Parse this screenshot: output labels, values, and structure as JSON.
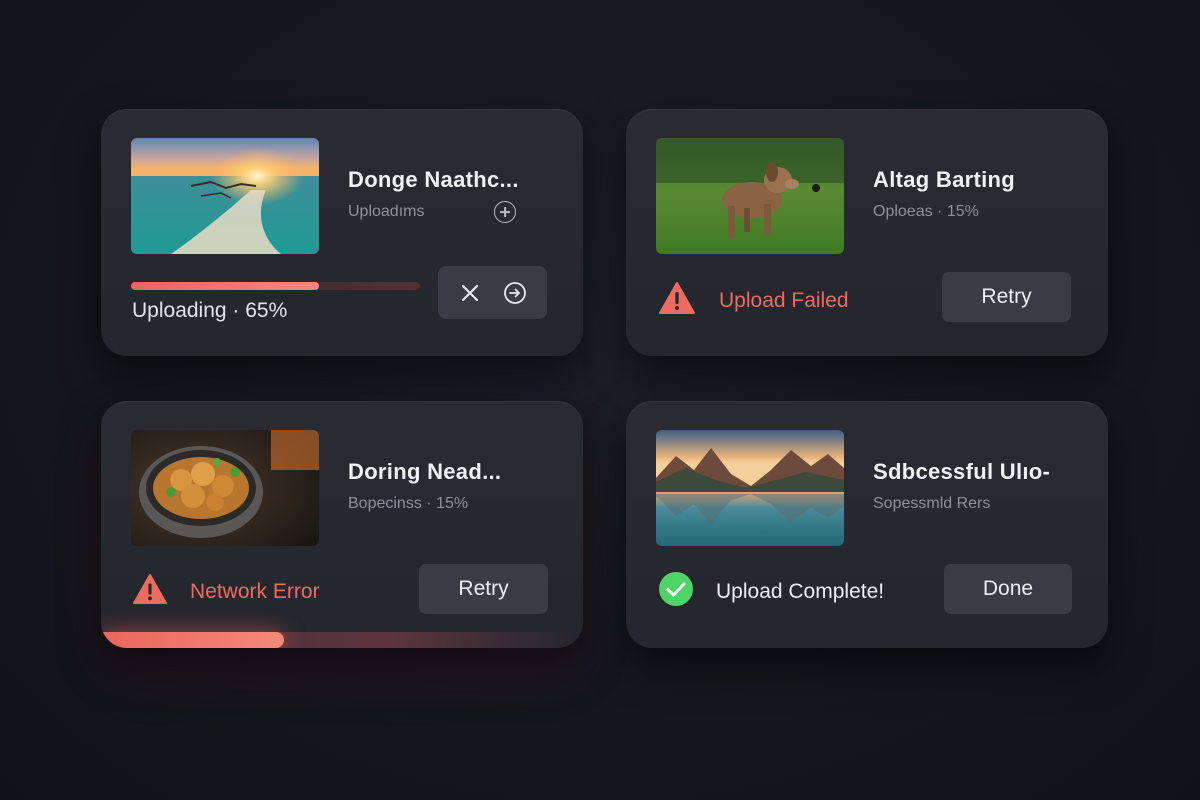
{
  "cards": [
    {
      "title": "Donge Naathc...",
      "subtitle": "Uploadıms",
      "progress_label": "Uploading · 65%",
      "progress_percent": 65,
      "thumbnail": "beach-sunset-image",
      "actions": [
        "close-icon",
        "arrow-circle-icon"
      ]
    },
    {
      "title": "Altag Barting",
      "subtitle": "Oploeas · 15%",
      "thumbnail": "dog-on-grass-image",
      "status": "Upload Failed",
      "status_icon": "warning-icon",
      "button": "Retry"
    },
    {
      "title": "Doring Nead...",
      "subtitle": "Bopecinss · 15%",
      "thumbnail": "food-bowl-image",
      "status": "Network Error",
      "status_icon": "warning-icon",
      "button": "Retry",
      "progress_percent": 38
    },
    {
      "title": "Sdbcessful Ulıo-",
      "subtitle": "Sopessmld Rers",
      "thumbnail": "mountain-lake-image",
      "status": "Upload Complete!",
      "status_icon": "check-circle-icon",
      "button": "Done"
    }
  ],
  "colors": {
    "accent_error": "#ee6c5f",
    "accent_success": "#4fd468",
    "card_bg": "#26272f",
    "button_bg": "#3a3b44"
  }
}
